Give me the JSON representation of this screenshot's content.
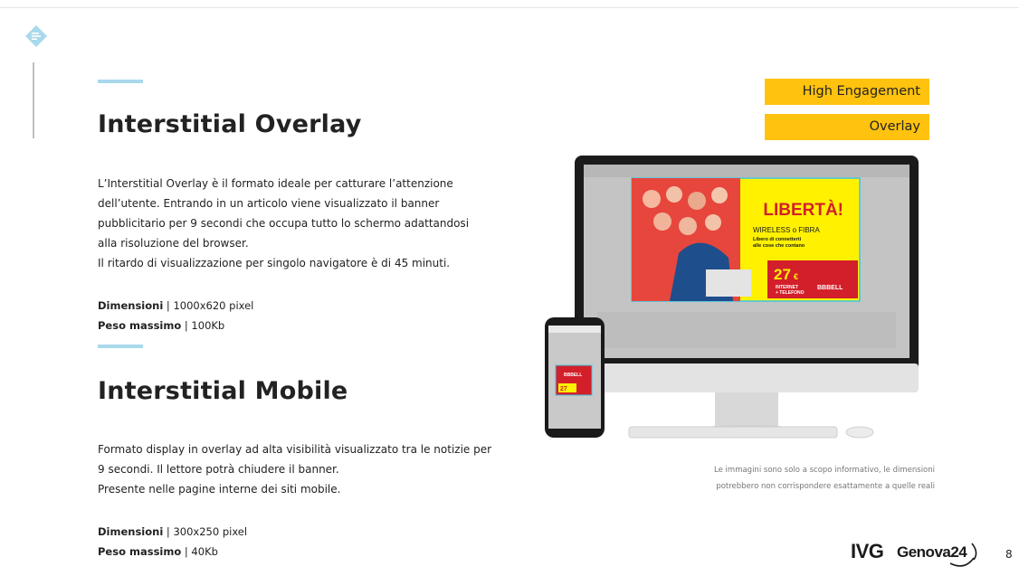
{
  "sections": [
    {
      "title": "Interstitial Overlay",
      "paragraph_lines": [
        "L’Interstitial Overlay è il formato ideale per catturare l’attenzione",
        "dell’utente. Entrando in un articolo viene visualizzato il banner",
        "pubblicitario per 9 secondi che occupa tutto lo schermo adattandosi",
        "alla risoluzione del browser.",
        "Il ritardo di visualizzazione per singolo navigatore è di 45 minuti."
      ],
      "dim_label": "Dimensioni",
      "dim_value": " | 1000x620 pixel",
      "weight_label": "Peso massimo",
      "weight_value": " | 100Kb"
    },
    {
      "title": "Interstitial Mobile",
      "paragraph_lines": [
        "Formato display in overlay ad alta visibilità visualizzato tra le notizie per",
        "9 secondi. Il lettore potrà chiudere il banner.",
        "Presente nelle pagine interne dei siti mobile."
      ],
      "dim_label": "Dimensioni",
      "dim_value": " | 300x250 pixel",
      "weight_label": "Peso massimo",
      "weight_value": " | 40Kb"
    }
  ],
  "badges": [
    "High Engagement",
    "Overlay"
  ],
  "disclaimer_lines": [
    "Le immagini sono solo a scopo informativo, le dimensioni",
    "potrebbero non corrispondere esattamente a quelle reali"
  ],
  "ad_banner": {
    "headline": "LIBERTÀ!",
    "sub1": "WIRELESS o FIBRA",
    "sub2": "Libero di connetterti",
    "sub3": "alle cose che contano",
    "price": "27",
    "currency": "€",
    "price_caption1": "INTERNET",
    "price_caption2": "+ TELEFONO",
    "brand": "BBBELL"
  },
  "logos": {
    "ivg": "IVG",
    "genova": "Genova24"
  },
  "page_number": "8",
  "colors": {
    "accent_blue": "#a9d9ec",
    "badge_yellow": "#ffc20e",
    "ad_red": "#d31f2a",
    "ad_yellow": "#fff100"
  }
}
